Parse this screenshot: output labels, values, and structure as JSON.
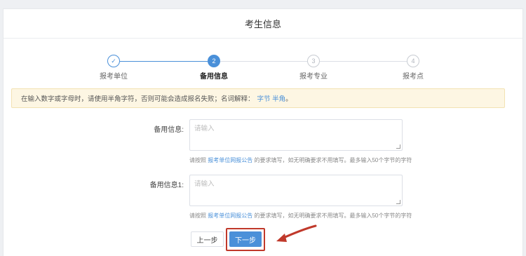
{
  "header": {
    "title": "考生信息"
  },
  "steps": [
    {
      "label": "报考单位",
      "marker": "✓",
      "state": "done"
    },
    {
      "label": "备用信息",
      "marker": "2",
      "state": "active"
    },
    {
      "label": "报考专业",
      "marker": "3",
      "state": "pending"
    },
    {
      "label": "报考点",
      "marker": "4",
      "state": "pending"
    }
  ],
  "notice": {
    "text": "在输入数字或字母时，请使用半角字符，否则可能会造成报名失败；名词解释：",
    "link": "字节 半角",
    "suffix": "。"
  },
  "form": {
    "fields": [
      {
        "label": "备用信息:",
        "placeholder": "请输入",
        "hint_prefix": "请按照 ",
        "hint_link": "报考单位网报公告",
        "hint_suffix": " 的要求填写，如无明确要求不用填写。最多输入50个字节的字符"
      },
      {
        "label": "备用信息1:",
        "placeholder": "请输入",
        "hint_prefix": "请按照 ",
        "hint_link": "报考单位网报公告",
        "hint_suffix": " 的要求填写，如无明确要求不用填写。最多输入50个字节的字符"
      }
    ]
  },
  "buttons": {
    "prev": "上一步",
    "next": "下一步"
  },
  "colors": {
    "primary": "#4a90d9",
    "annotation": "#c0392b",
    "notice_bg": "#fdf6e3"
  }
}
